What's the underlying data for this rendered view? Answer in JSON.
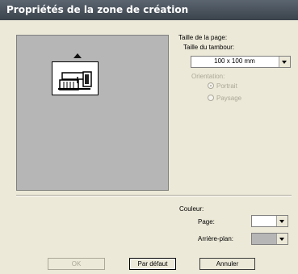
{
  "window": {
    "title": "Propriétés de la zone de création"
  },
  "page_size": {
    "heading": "Taille de la page:",
    "hoop_label": "Taille du tambour:",
    "hoop_value": "100 x 100 mm",
    "orientation_label": "Orientation:",
    "orientation_options": [
      {
        "label": "Portrait",
        "selected": true
      },
      {
        "label": "Paysage",
        "selected": false
      }
    ]
  },
  "color": {
    "heading": "Couleur:",
    "page_label": "Page:",
    "page_color": "#ffffff",
    "background_label": "Arrière-plan:",
    "background_color": "#b6b6b6"
  },
  "buttons": {
    "ok": "OK",
    "default": "Par défaut",
    "cancel": "Annuler"
  },
  "icons": {
    "arrow": "up-arrow-icon",
    "machine": "sewing-machine-icon"
  }
}
